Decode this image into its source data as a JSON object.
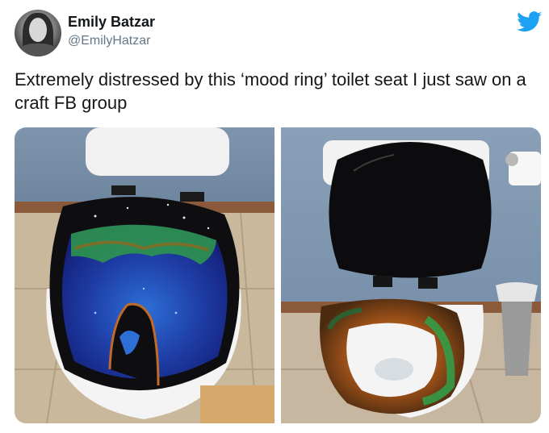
{
  "tweet": {
    "author_name": "Emily Batzar",
    "author_handle": "@EmilyHatzar",
    "text": "Extremely distressed by this ‘mood ring’ toilet seat I just saw on a craft FB group"
  },
  "icons": {
    "platform": "twitter-bird-icon",
    "brand_color": "#1da1f2"
  },
  "media": {
    "count": 2
  }
}
